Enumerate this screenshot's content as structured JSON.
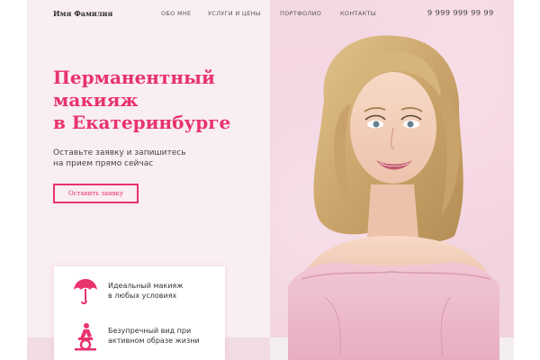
{
  "header": {
    "brand": "Имя Фамилия",
    "nav": [
      "ОБО МНЕ",
      "УСЛУГИ И ЦЕНЫ",
      "ПОРТФОЛИО",
      "КОНТАКТЫ"
    ],
    "phone": "9 999 999 99 99"
  },
  "hero": {
    "title_lines": [
      "Перманентный",
      "макияж",
      "в Екатеринбурге"
    ],
    "subtitle_lines": [
      "Оставьте заявку и запишитесь",
      "на прием прямо сейчас"
    ],
    "cta_label": "Оставить заявку"
  },
  "features": [
    {
      "icon": "umbrella-icon",
      "lines": [
        "Идеальный макияж",
        "в любых условиях"
      ]
    },
    {
      "icon": "exercise-bike-icon",
      "lines": [
        "Безупречный вид при",
        "активном образе жизни"
      ]
    }
  ],
  "colors": {
    "accent": "#e8336d",
    "background": "#f9eef2",
    "text": "#333333"
  }
}
